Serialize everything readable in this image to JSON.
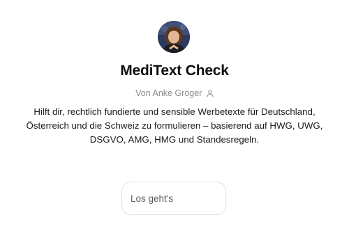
{
  "gpt": {
    "name": "MediText Check",
    "author_line": "Von Anke Gröger",
    "description": "Hilft dir, rechtlich fundierte und sensible Werbetexte für Deutschland, Österreich und die Schweiz zu formulieren – basierend auf HWG, UWG, DSGVO, AMG, HMG und Standesregeln.",
    "avatar_icon": "author-photo",
    "author_icon": "person-icon"
  },
  "conversation_starters": [
    {
      "label": "Los geht's"
    }
  ],
  "colors": {
    "title": "#0d0d0d",
    "author": "#8a8a8a",
    "body_text": "#1a1a1a",
    "starter_border": "#e3e3e3"
  }
}
